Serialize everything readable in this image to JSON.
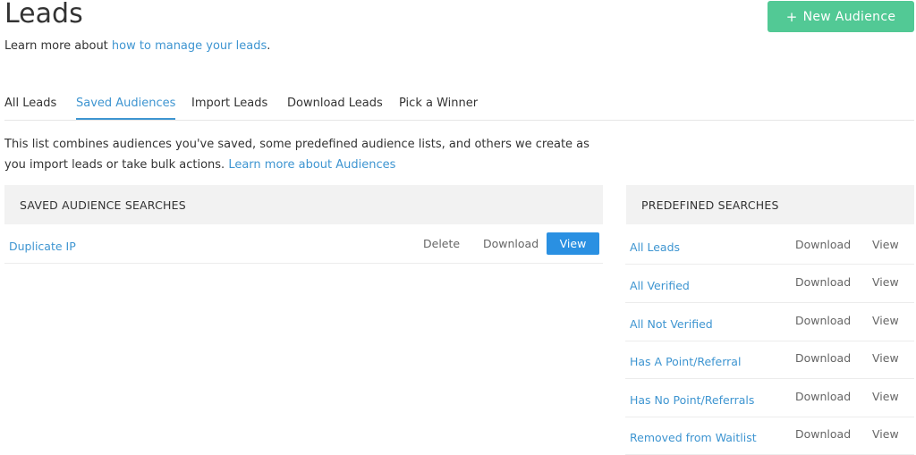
{
  "page": {
    "title": "Leads",
    "new_audience_label": "New Audience",
    "subtitle_prefix": "Learn more about ",
    "subtitle_link": "how to manage your leads",
    "subtitle_suffix": "."
  },
  "tabs": [
    {
      "label": "All Leads",
      "active": false
    },
    {
      "label": "Saved Audiences",
      "active": true
    },
    {
      "label": "Import Leads",
      "active": false
    },
    {
      "label": "Download Leads",
      "active": false
    },
    {
      "label": "Pick a Winner",
      "active": false
    }
  ],
  "description": {
    "text": "This list combines audiences you've saved, some predefined audience lists, and others we create as you import leads or take bulk actions. ",
    "link": "Learn more about Audiences"
  },
  "saved": {
    "header": "SAVED AUDIENCE SEARCHES",
    "rows": [
      {
        "name": "Duplicate IP",
        "delete": "Delete",
        "download": "Download",
        "view": "View"
      }
    ]
  },
  "predefined": {
    "header": "PREDEFINED SEARCHES",
    "rows": [
      {
        "name": "All Leads",
        "download": "Download",
        "view": "View"
      },
      {
        "name": "All Verified",
        "download": "Download",
        "view": "View"
      },
      {
        "name": "All Not Verified",
        "download": "Download",
        "view": "View"
      },
      {
        "name": "Has A Point/Referral",
        "download": "Download",
        "view": "View"
      },
      {
        "name": "Has No Point/Referrals",
        "download": "Download",
        "view": "View"
      },
      {
        "name": "Removed from Waitlist",
        "download": "Download",
        "view": "View"
      }
    ]
  },
  "colors": {
    "accent": "#3e95d1",
    "new_button": "#52c995",
    "view_button": "#2a90e2",
    "header_bg": "#f2f2f2"
  }
}
